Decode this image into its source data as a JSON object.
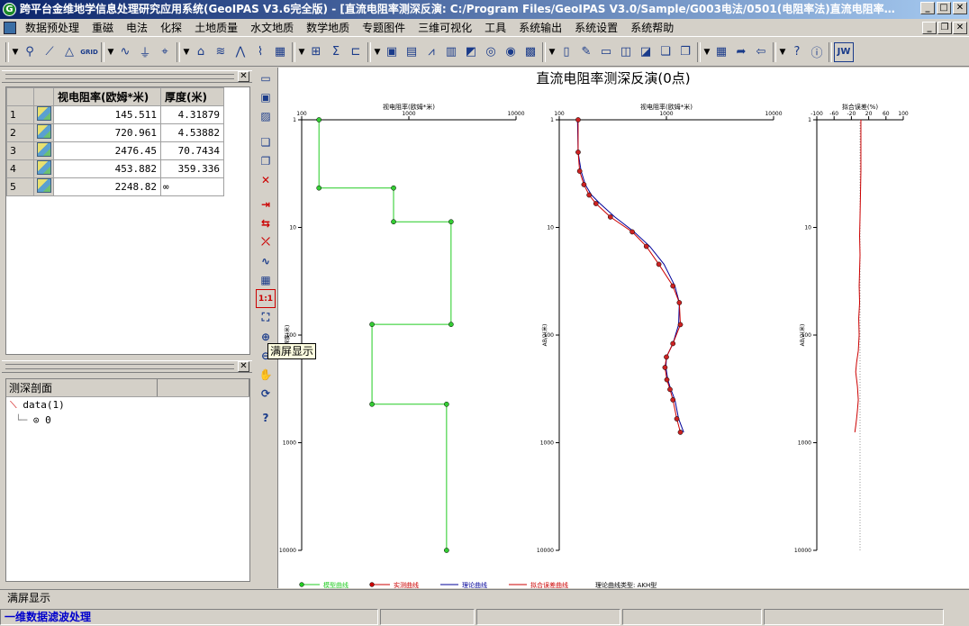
{
  "window": {
    "app_icon": "G",
    "title": "跨平台金维地学信息处理研究应用系统(GeoIPAS V3.6完全版) - [直流电阻率测深反演: C:/Program Files/GeoIPAS V3.0/Sample/G003电法/0501(电阻率法)直流电阻率测深反演/..."
  },
  "menu": [
    "数据预处理",
    "重磁",
    "电法",
    "化探",
    "土地质量",
    "水文地质",
    "数学地质",
    "专题图件",
    "三维可视化",
    "工具",
    "系统输出",
    "系统设置",
    "系统帮助"
  ],
  "toolbar_labels": {
    "grid": "GRID",
    "jw": "JW"
  },
  "layer_table": {
    "headers": [
      "视电阻率(欧姆*米)",
      "厚度(米)"
    ],
    "rows": [
      {
        "n": "1",
        "rho": "145.511",
        "h": "4.31879"
      },
      {
        "n": "2",
        "rho": "720.961",
        "h": "4.53882"
      },
      {
        "n": "3",
        "rho": "2476.45",
        "h": "70.7434"
      },
      {
        "n": "4",
        "rho": "453.882",
        "h": "359.336"
      },
      {
        "n": "5",
        "rho": "2248.82",
        "h": "∞"
      }
    ]
  },
  "tree": {
    "header": "测深剖面",
    "root": "data(1)",
    "child": "0"
  },
  "tooltip": "满屏显示",
  "status_row": "满屏显示",
  "status_bar": [
    "一维数据滤波处理",
    "",
    "",
    "",
    ""
  ],
  "chart_data": {
    "type": "line",
    "title": "直流电阻率测深反演(0点)",
    "panels": [
      {
        "xlabel": "视电阻率(欧姆*米)",
        "ylabel": "深度(米)",
        "x_ticks": [
          "100",
          "1000",
          "10000"
        ],
        "y_ticks": [
          "1",
          "10",
          "100",
          "1000",
          "10000"
        ],
        "log_x": true,
        "log_y": true
      },
      {
        "xlabel": "视电阻率(欧姆*米)",
        "ylabel": "AB/2(米)",
        "x_ticks": [
          "100",
          "1000",
          "10000"
        ],
        "y_ticks": [
          "1",
          "10",
          "100",
          "1000",
          "10000"
        ],
        "log_x": true,
        "log_y": true
      },
      {
        "xlabel": "拟合误差(%)",
        "ylabel": "AB/2(米)",
        "x_ticks": [
          "-100",
          "-60",
          "-20",
          "20",
          "60",
          "100"
        ],
        "y_ticks": [
          "1",
          "10",
          "100",
          "1000",
          "10000"
        ],
        "log_x": false,
        "log_y": true
      }
    ],
    "layer_model": {
      "name": "模型曲线",
      "color": "#22cc22",
      "x": [
        145,
        145,
        720,
        720,
        2476,
        2476,
        453,
        453,
        2248,
        2248
      ],
      "y": [
        1,
        4.3,
        4.3,
        8.86,
        8.86,
        79.6,
        79.6,
        439,
        439,
        10000
      ]
    },
    "measured": {
      "name": "实测曲线",
      "color": "#cc0000",
      "x": [
        150,
        150,
        155,
        170,
        190,
        220,
        300,
        480,
        650,
        850,
        1150,
        1320,
        1350,
        1150,
        1000,
        970,
        1010,
        1080,
        1150,
        1250,
        1350
      ],
      "y": [
        1,
        2,
        3,
        4,
        5,
        6,
        8,
        11,
        15,
        22,
        35,
        50,
        80,
        120,
        160,
        200,
        260,
        320,
        400,
        600,
        800
      ]
    },
    "theory": {
      "name": "理论曲线",
      "color": "#000099",
      "x": [
        148,
        150,
        160,
        175,
        200,
        240,
        330,
        500,
        700,
        950,
        1200,
        1320,
        1300,
        1150,
        1000,
        990,
        1030,
        1100,
        1200,
        1300,
        1450
      ],
      "y": [
        1,
        2,
        3,
        4,
        5,
        6,
        8,
        11,
        15,
        22,
        35,
        50,
        80,
        120,
        160,
        200,
        260,
        320,
        400,
        600,
        800
      ]
    },
    "error": {
      "name": "拟合误差曲线",
      "color": "#cc0000",
      "x": [
        2,
        2,
        1,
        0,
        -1,
        0,
        -1,
        -2,
        -1,
        -3,
        -2,
        -4,
        -8,
        -10,
        -6,
        -4,
        -6,
        -8,
        -10,
        -12
      ],
      "y": [
        1,
        3,
        5,
        8,
        12,
        18,
        25,
        35,
        50,
        70,
        100,
        140,
        180,
        220,
        300,
        400,
        500,
        600,
        700,
        800
      ]
    },
    "legend_extra": "理论曲线类型: AKH型"
  }
}
